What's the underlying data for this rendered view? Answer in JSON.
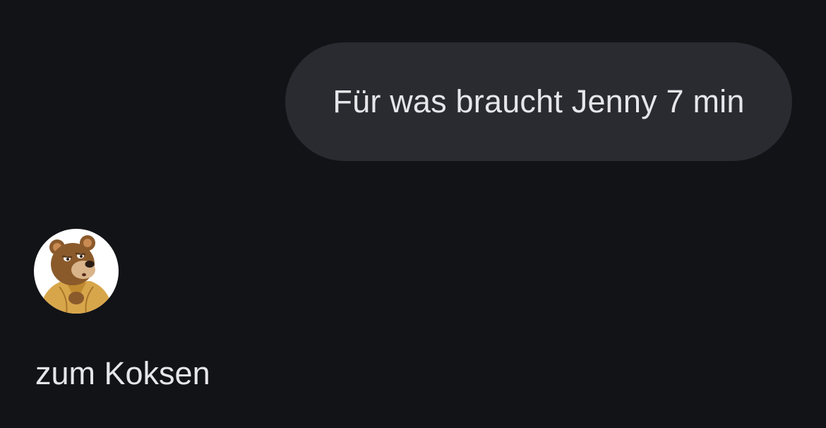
{
  "conversation": {
    "messages": [
      {
        "sender": "user",
        "text": "Für was braucht Jenny 7 min"
      },
      {
        "sender": "assistant",
        "avatar_icon": "bear-avatar-icon",
        "text": "zum Koksen"
      }
    ]
  },
  "colors": {
    "background": "#121317",
    "sent_bubble": "#2a2b30",
    "text": "#e6e6ea"
  }
}
